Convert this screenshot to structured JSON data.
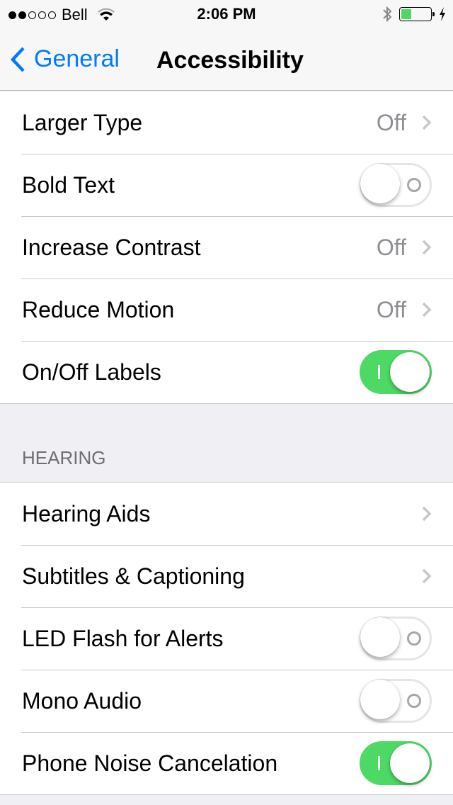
{
  "status_bar": {
    "signal_filled": 2,
    "signal_total": 5,
    "carrier": "Bell",
    "time": "2:06 PM",
    "battery_level_percent": 35,
    "battery_color": "#4cd964",
    "charging": true,
    "bluetooth": true
  },
  "nav": {
    "back_label": "General",
    "title": "Accessibility",
    "accent": "#007aff"
  },
  "groups": [
    {
      "header": "",
      "rows": [
        {
          "label": "Larger Type",
          "type": "disclosure",
          "value": "Off"
        },
        {
          "label": "Bold Text",
          "type": "toggle",
          "on": false
        },
        {
          "label": "Increase Contrast",
          "type": "disclosure",
          "value": "Off"
        },
        {
          "label": "Reduce Motion",
          "type": "disclosure",
          "value": "Off"
        },
        {
          "label": "On/Off Labels",
          "type": "toggle",
          "on": true
        }
      ]
    },
    {
      "header": "HEARING",
      "rows": [
        {
          "label": "Hearing Aids",
          "type": "disclosure",
          "value": ""
        },
        {
          "label": "Subtitles & Captioning",
          "type": "disclosure",
          "value": ""
        },
        {
          "label": "LED Flash for Alerts",
          "type": "toggle",
          "on": false
        },
        {
          "label": "Mono Audio",
          "type": "toggle",
          "on": false
        },
        {
          "label": "Phone Noise Cancelation",
          "type": "toggle",
          "on": true
        }
      ]
    }
  ],
  "colors": {
    "toggle_on": "#4cd964",
    "background": "#efeff4"
  }
}
